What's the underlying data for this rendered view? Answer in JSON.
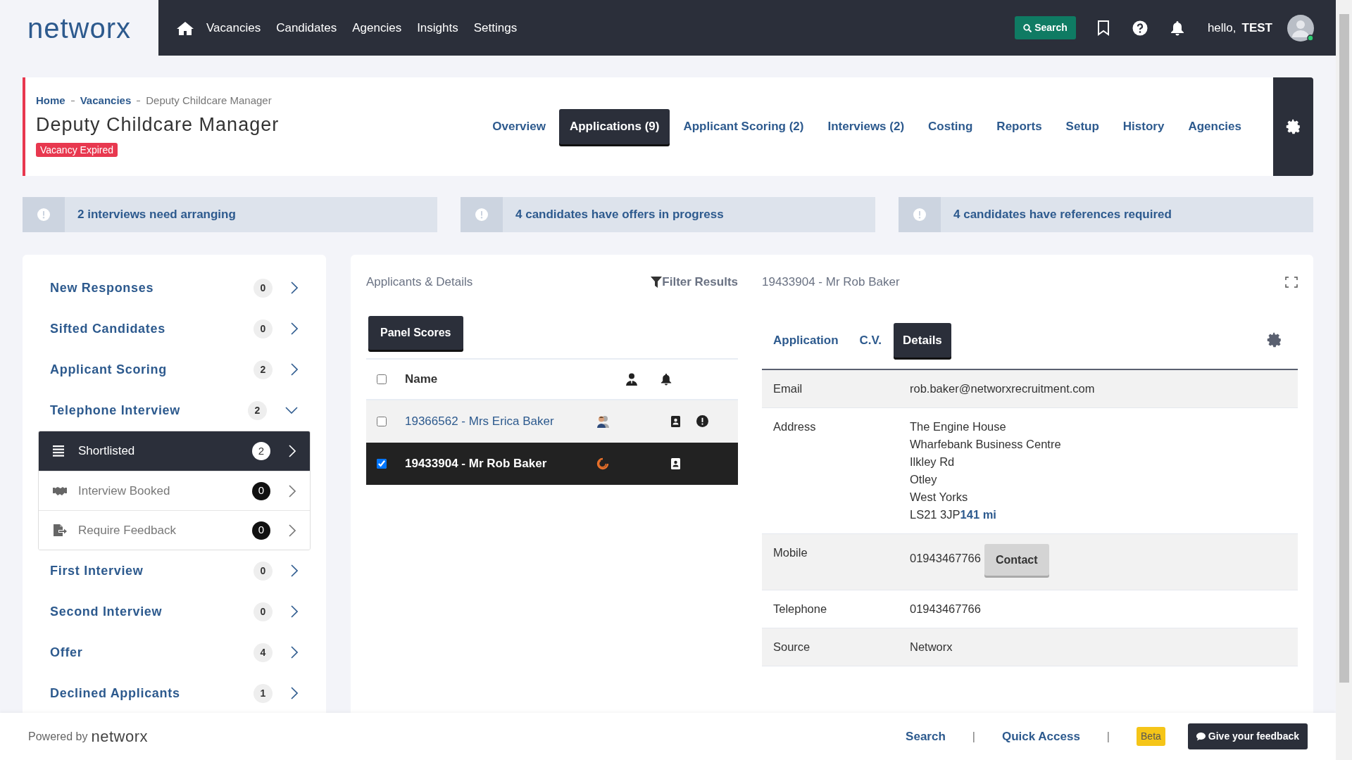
{
  "topbar": {
    "logo": "networx",
    "nav": [
      {
        "label": "Vacancies"
      },
      {
        "label": "Candidates"
      },
      {
        "label": "Agencies"
      },
      {
        "label": "Insights"
      },
      {
        "label": "Settings"
      }
    ],
    "search_button": "Search",
    "greeting": "hello,",
    "user_name": "TEST"
  },
  "header": {
    "breadcrumbs": [
      {
        "label": "Home",
        "current": false
      },
      {
        "label": "Vacancies",
        "current": false
      },
      {
        "label": "Deputy Childcare Manager",
        "current": true
      }
    ],
    "title": "Deputy Childcare Manager",
    "status_badge": "Vacancy Expired",
    "tabs": [
      {
        "label": "Overview",
        "selected": false
      },
      {
        "label": "Applications (9)",
        "selected": true
      },
      {
        "label": "Applicant Scoring (2)",
        "selected": false
      },
      {
        "label": "Interviews (2)",
        "selected": false
      },
      {
        "label": "Costing",
        "selected": false
      },
      {
        "label": "Reports",
        "selected": false
      },
      {
        "label": "Setup",
        "selected": false
      },
      {
        "label": "History",
        "selected": false
      },
      {
        "label": "Agencies",
        "selected": false
      }
    ]
  },
  "alerts": [
    "2 interviews need arranging",
    "4 candidates have offers in progress",
    "4 candidates have references required"
  ],
  "stages": [
    {
      "label": "New Responses",
      "count": "0",
      "expanded": false
    },
    {
      "label": "Sifted Candidates",
      "count": "0",
      "expanded": false
    },
    {
      "label": "Applicant Scoring",
      "count": "2",
      "expanded": false
    },
    {
      "label": "Telephone Interview",
      "count": "2",
      "expanded": true,
      "children": [
        {
          "kind": "list",
          "label": "Shortlisted",
          "count": "2",
          "selected": true
        },
        {
          "kind": "handshake",
          "label": "Interview Booked",
          "count": "0",
          "selected": false
        },
        {
          "kind": "feedback",
          "label": "Require Feedback",
          "count": "0",
          "selected": false
        }
      ]
    },
    {
      "label": "First Interview",
      "count": "0",
      "expanded": false
    },
    {
      "label": "Second Interview",
      "count": "0",
      "expanded": false
    },
    {
      "label": "Offer",
      "count": "4",
      "expanded": false
    },
    {
      "label": "Declined Applicants",
      "count": "1",
      "expanded": false
    }
  ],
  "applicants": {
    "title": "Applicants & Details",
    "filter": "Filter Results",
    "panel_button": "Panel Scores",
    "name_column": "Name",
    "all_checked": false,
    "rows": [
      {
        "name": "19366562 - Mrs Erica Baker",
        "selected": false,
        "checked": false,
        "kind": "people",
        "alert": true
      },
      {
        "name": "19433904 - Mr Rob Baker",
        "selected": true,
        "checked": true,
        "kind": "swirl",
        "alert": false
      }
    ]
  },
  "details": {
    "title": "19433904 - Mr Rob Baker",
    "tabs": [
      {
        "label": "Application",
        "selected": false
      },
      {
        "label": "C.V.",
        "selected": false
      },
      {
        "label": "Details",
        "selected": true
      }
    ],
    "fields": [
      {
        "label": "Email",
        "lines": [
          "rob.baker@networxrecruitment.com"
        ]
      },
      {
        "label": "Address",
        "lines": [
          "The Engine House",
          "Wharfebank Business Centre",
          "Ilkley Rd",
          "Otley",
          "West Yorks",
          "LS21 3JP"
        ],
        "distance": "141 mi"
      },
      {
        "label": "Mobile",
        "lines": [
          "01943467766"
        ],
        "action": "Contact"
      },
      {
        "label": "Telephone",
        "lines": [
          "01943467766"
        ]
      },
      {
        "label": "Source",
        "lines": [
          "Networx"
        ]
      }
    ]
  },
  "footer": {
    "powered_by": "Powered by",
    "brand": "networx",
    "links": [
      "Search",
      "|",
      "Quick Access",
      "|"
    ],
    "beta": "Beta",
    "feedback": "Give your feedback"
  }
}
